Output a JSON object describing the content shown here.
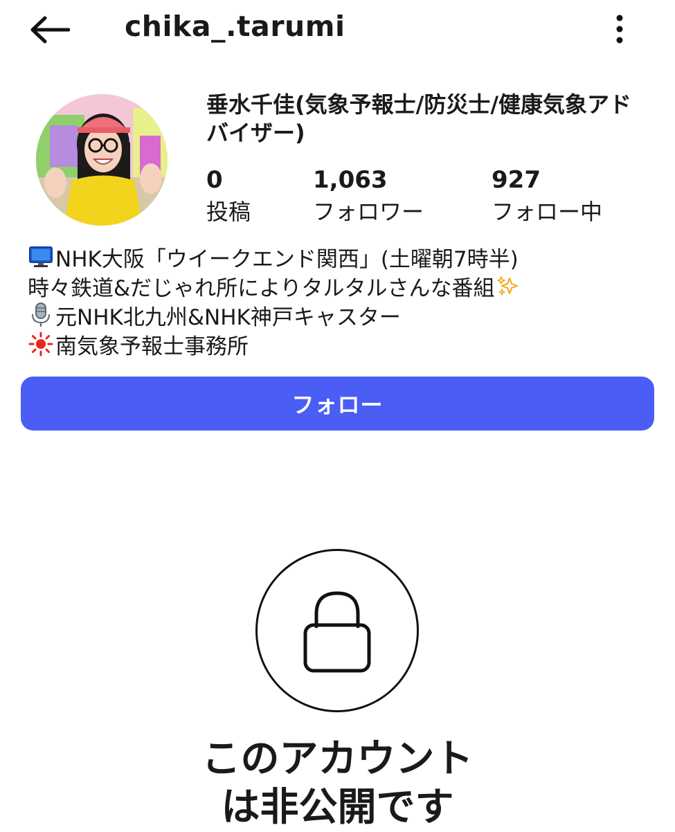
{
  "header": {
    "back_icon": "arrow-left-icon",
    "username": "chika_.tarumi",
    "more_icon": "more-vertical-icon"
  },
  "profile": {
    "display_name": "垂水千佳(気象予報士/防災士/健康気象アドバイザー)",
    "stats": {
      "posts_count": "0",
      "posts_label": "投稿",
      "followers_count": "1,063",
      "followers_label": "フォロワー",
      "following_count": "927",
      "following_label": "フォロー中"
    }
  },
  "bio": {
    "line1_icon": "computer-icon",
    "line1": "NHK大阪「ウイークエンド関西」(土曜朝7時半)",
    "line2": "時々鉄道&だじゃれ所によりタルタルさんな番組",
    "line2_icon": "sparkles-icon",
    "line3_icon": "microphone-icon",
    "line3": "元NHK北九州&NHK神戸キャスター",
    "line4_icon": "sun-icon",
    "line4": "南気象予報士事務所"
  },
  "follow_button": {
    "label": "フォロー",
    "color": "#4a5ef5"
  },
  "private_notice": {
    "icon": "lock-icon",
    "line1": "このアカウント",
    "line2": "は非公開です"
  }
}
